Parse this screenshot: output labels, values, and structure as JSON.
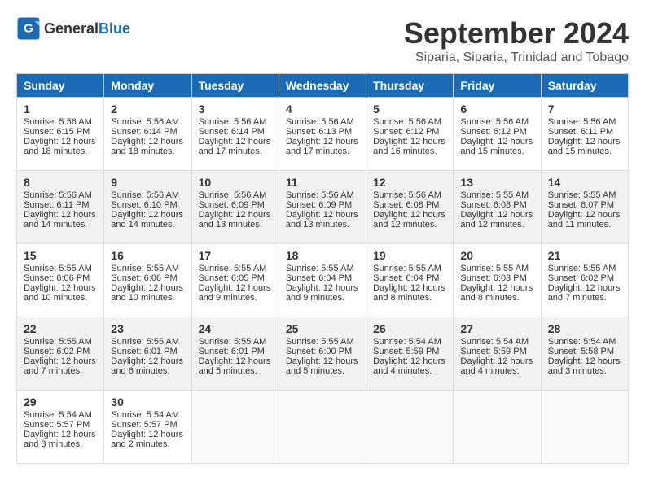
{
  "header": {
    "logo_general": "General",
    "logo_blue": "Blue",
    "month_title": "September 2024",
    "subtitle": "Siparia, Siparia, Trinidad and Tobago"
  },
  "days_of_week": [
    "Sunday",
    "Monday",
    "Tuesday",
    "Wednesday",
    "Thursday",
    "Friday",
    "Saturday"
  ],
  "weeks": [
    [
      {
        "day": "1",
        "sunrise": "5:56 AM",
        "sunset": "6:15 PM",
        "daylight": "12 hours and 18 minutes."
      },
      {
        "day": "2",
        "sunrise": "5:56 AM",
        "sunset": "6:14 PM",
        "daylight": "12 hours and 18 minutes."
      },
      {
        "day": "3",
        "sunrise": "5:56 AM",
        "sunset": "6:14 PM",
        "daylight": "12 hours and 17 minutes."
      },
      {
        "day": "4",
        "sunrise": "5:56 AM",
        "sunset": "6:13 PM",
        "daylight": "12 hours and 17 minutes."
      },
      {
        "day": "5",
        "sunrise": "5:56 AM",
        "sunset": "6:12 PM",
        "daylight": "12 hours and 16 minutes."
      },
      {
        "day": "6",
        "sunrise": "5:56 AM",
        "sunset": "6:12 PM",
        "daylight": "12 hours and 15 minutes."
      },
      {
        "day": "7",
        "sunrise": "5:56 AM",
        "sunset": "6:11 PM",
        "daylight": "12 hours and 15 minutes."
      }
    ],
    [
      {
        "day": "8",
        "sunrise": "5:56 AM",
        "sunset": "6:11 PM",
        "daylight": "12 hours and 14 minutes."
      },
      {
        "day": "9",
        "sunrise": "5:56 AM",
        "sunset": "6:10 PM",
        "daylight": "12 hours and 14 minutes."
      },
      {
        "day": "10",
        "sunrise": "5:56 AM",
        "sunset": "6:09 PM",
        "daylight": "12 hours and 13 minutes."
      },
      {
        "day": "11",
        "sunrise": "5:56 AM",
        "sunset": "6:09 PM",
        "daylight": "12 hours and 13 minutes."
      },
      {
        "day": "12",
        "sunrise": "5:56 AM",
        "sunset": "6:08 PM",
        "daylight": "12 hours and 12 minutes."
      },
      {
        "day": "13",
        "sunrise": "5:55 AM",
        "sunset": "6:08 PM",
        "daylight": "12 hours and 12 minutes."
      },
      {
        "day": "14",
        "sunrise": "5:55 AM",
        "sunset": "6:07 PM",
        "daylight": "12 hours and 11 minutes."
      }
    ],
    [
      {
        "day": "15",
        "sunrise": "5:55 AM",
        "sunset": "6:06 PM",
        "daylight": "12 hours and 10 minutes."
      },
      {
        "day": "16",
        "sunrise": "5:55 AM",
        "sunset": "6:06 PM",
        "daylight": "12 hours and 10 minutes."
      },
      {
        "day": "17",
        "sunrise": "5:55 AM",
        "sunset": "6:05 PM",
        "daylight": "12 hours and 9 minutes."
      },
      {
        "day": "18",
        "sunrise": "5:55 AM",
        "sunset": "6:04 PM",
        "daylight": "12 hours and 9 minutes."
      },
      {
        "day": "19",
        "sunrise": "5:55 AM",
        "sunset": "6:04 PM",
        "daylight": "12 hours and 8 minutes."
      },
      {
        "day": "20",
        "sunrise": "5:55 AM",
        "sunset": "6:03 PM",
        "daylight": "12 hours and 8 minutes."
      },
      {
        "day": "21",
        "sunrise": "5:55 AM",
        "sunset": "6:02 PM",
        "daylight": "12 hours and 7 minutes."
      }
    ],
    [
      {
        "day": "22",
        "sunrise": "5:55 AM",
        "sunset": "6:02 PM",
        "daylight": "12 hours and 7 minutes."
      },
      {
        "day": "23",
        "sunrise": "5:55 AM",
        "sunset": "6:01 PM",
        "daylight": "12 hours and 6 minutes."
      },
      {
        "day": "24",
        "sunrise": "5:55 AM",
        "sunset": "6:01 PM",
        "daylight": "12 hours and 5 minutes."
      },
      {
        "day": "25",
        "sunrise": "5:55 AM",
        "sunset": "6:00 PM",
        "daylight": "12 hours and 5 minutes."
      },
      {
        "day": "26",
        "sunrise": "5:54 AM",
        "sunset": "5:59 PM",
        "daylight": "12 hours and 4 minutes."
      },
      {
        "day": "27",
        "sunrise": "5:54 AM",
        "sunset": "5:59 PM",
        "daylight": "12 hours and 4 minutes."
      },
      {
        "day": "28",
        "sunrise": "5:54 AM",
        "sunset": "5:58 PM",
        "daylight": "12 hours and 3 minutes."
      }
    ],
    [
      {
        "day": "29",
        "sunrise": "5:54 AM",
        "sunset": "5:57 PM",
        "daylight": "12 hours and 3 minutes."
      },
      {
        "day": "30",
        "sunrise": "5:54 AM",
        "sunset": "5:57 PM",
        "daylight": "12 hours and 2 minutes."
      },
      null,
      null,
      null,
      null,
      null
    ]
  ]
}
